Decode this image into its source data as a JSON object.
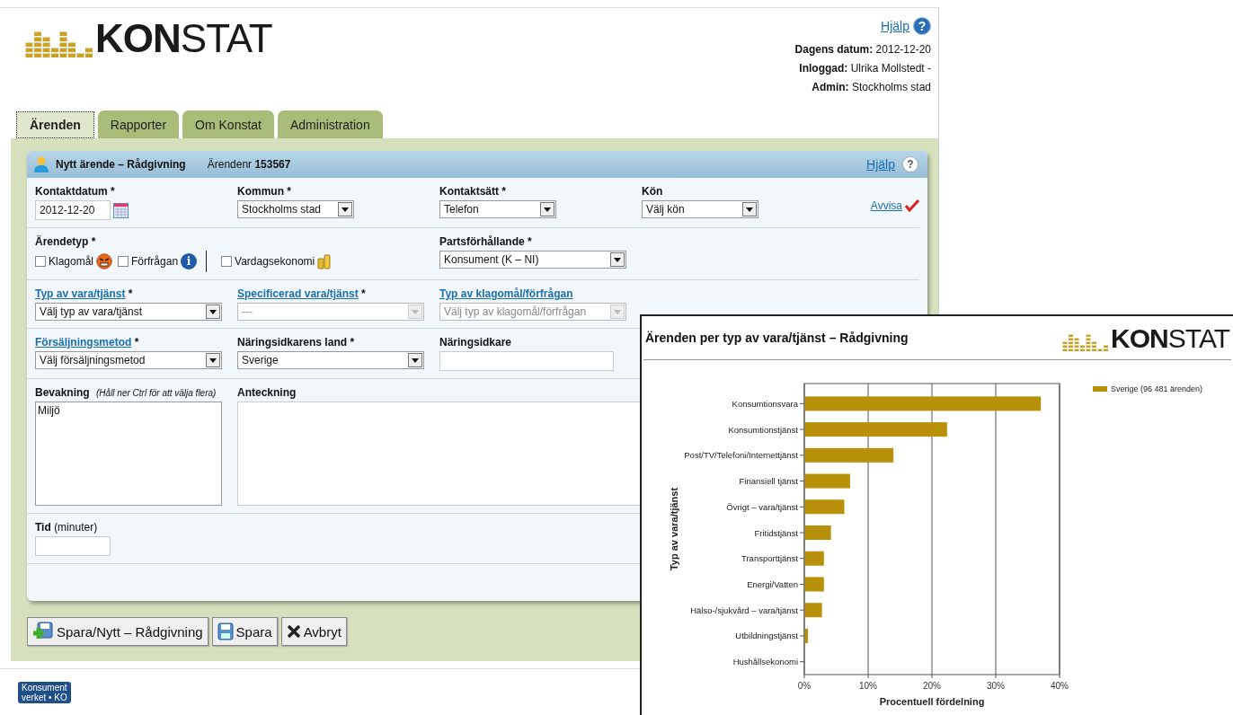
{
  "header": {
    "logo": {
      "bold": "KON",
      "light": "STAT"
    },
    "help": {
      "label": "Hjälp",
      "glyph": "?"
    },
    "info": [
      {
        "label": "Dagens datum:",
        "value": "2012-12-20"
      },
      {
        "label": "Inloggad:",
        "value": "Ulrika Mollstedt -"
      },
      {
        "label": "Admin:",
        "value": "Stockholms stad"
      }
    ]
  },
  "tabs": [
    {
      "label": "Ärenden",
      "selected": true
    },
    {
      "label": "Rapporter",
      "selected": false
    },
    {
      "label": "Om Konstat",
      "selected": false
    },
    {
      "label": "Administration",
      "selected": false
    }
  ],
  "panel": {
    "title": "Nytt ärende – Rådgivning",
    "case_label": "Ärendenr",
    "case_number": "153567",
    "help": {
      "label": "Hjälp",
      "glyph": "?"
    },
    "rows": [
      {
        "fields": [
          {
            "kind": "date",
            "label": "Kontaktdatum",
            "mark": "*",
            "link": false,
            "value": "2012-12-20"
          },
          {
            "kind": "select",
            "label": "Kommun",
            "mark": "*",
            "link": false,
            "value": "Stockholms stad",
            "disabled": false
          },
          {
            "kind": "select",
            "label": "Kontaktsätt",
            "mark": "*",
            "link": false,
            "value": "Telefon",
            "disabled": false
          },
          {
            "kind": "select",
            "label": "Kön",
            "link": false,
            "value": "Välj kön",
            "disabled": false
          },
          {
            "kind": "action",
            "label": "Avvisa"
          }
        ]
      },
      {
        "fields": [
          {
            "kind": "checkgroup",
            "label": "Ärendetyp",
            "mark": "*",
            "link": false,
            "options": [
              {
                "label": "Klagomål",
                "checked": false,
                "kind": "angry"
              },
              {
                "label": "Förfrågan",
                "checked": false,
                "kind": "info",
                "glyph": "i"
              },
              {
                "label": "Vardagsekonomi",
                "checked": false,
                "kind": "coins",
                "divider_before": true
              }
            ]
          },
          {
            "kind": "select",
            "label": "Partsförhållande",
            "mark": "*",
            "link": false,
            "value": "Konsument (K – NI)",
            "disabled": false
          }
        ]
      },
      {
        "fields": [
          {
            "kind": "select",
            "label": "Typ av vara/tjänst",
            "mark": "*",
            "link": true,
            "value": "Välj typ av vara/tjänst",
            "disabled": false
          },
          {
            "kind": "select",
            "label": "Specificerad vara/tjänst",
            "mark": "*",
            "link": true,
            "value": "---",
            "disabled": true
          },
          {
            "kind": "select",
            "label": "Typ av klagomål/förfrågan",
            "link": true,
            "value": "Välj typ av klagomål/förfrågan",
            "disabled": true
          }
        ]
      },
      {
        "fields": [
          {
            "kind": "select",
            "label": "Försäljningsmetod",
            "mark": "*",
            "link": true,
            "value": "Välj försäljningsmetod",
            "disabled": false
          },
          {
            "kind": "select",
            "label": "Näringsidkarens land",
            "mark": "*",
            "link": false,
            "value": "Sverige",
            "disabled": false
          },
          {
            "kind": "text",
            "label": "Näringsidkare",
            "link": false
          }
        ]
      },
      {
        "fields": [
          {
            "kind": "listbox",
            "label": "Bevakning",
            "hint": "(Håll ner Ctrl för att välja flera)",
            "link": false,
            "options": [
              "Miljö"
            ]
          },
          {
            "kind": "textarea",
            "label": "Anteckning",
            "link": false
          }
        ]
      },
      {
        "fields": [
          {
            "kind": "text",
            "label": "Tid",
            "unit": "(minuter)",
            "link": false
          }
        ]
      }
    ]
  },
  "buttons": [
    {
      "label": "Spara/Nytt – Rådgivning",
      "kind": "save-new"
    },
    {
      "label": "Spara",
      "kind": "save"
    },
    {
      "label": "Avbryt",
      "kind": "cancel"
    }
  ],
  "footer": {
    "logo": [
      "Konsument",
      "verket • KO"
    ]
  },
  "chart_window": {
    "title": "Ärenden per typ av vara/tjänst – Rådgivning",
    "logo": {
      "bold": "KON",
      "light": "STAT"
    },
    "chart_data": {
      "type": "bar",
      "orientation": "horizontal",
      "grid": true,
      "xlabel": "Procentuell fördelning",
      "ylabel": "Typ av vara/tjänst",
      "categories": [
        "Konsumtionsvara",
        "Konsumtionstjänst",
        "Post/TV/Telefoni/Internettjänst",
        "Finansiell tjänst",
        "Övrigt – vara/tjänst",
        "Fritidstjänst",
        "Transporttjänst",
        "Energi/Vatten",
        "Hälso-/sjukvård – vara/tjänst",
        "Utbildningstjänst",
        "Hushållsekonomi"
      ],
      "series": [
        {
          "name": "Sverige (96 481 ärenden)",
          "color": "#b8900a",
          "values": [
            37.0,
            22.3,
            13.9,
            7.1,
            6.2,
            4.1,
            3.0,
            3.0,
            2.7,
            0.5,
            0
          ]
        }
      ],
      "xlim": [
        0,
        40
      ],
      "xticks": [
        {
          "value": 0,
          "label": "0%"
        },
        {
          "value": 10,
          "label": "10%"
        },
        {
          "value": 20,
          "label": "20%"
        },
        {
          "value": 30,
          "label": "30%"
        },
        {
          "value": 40,
          "label": "40%"
        }
      ]
    }
  }
}
